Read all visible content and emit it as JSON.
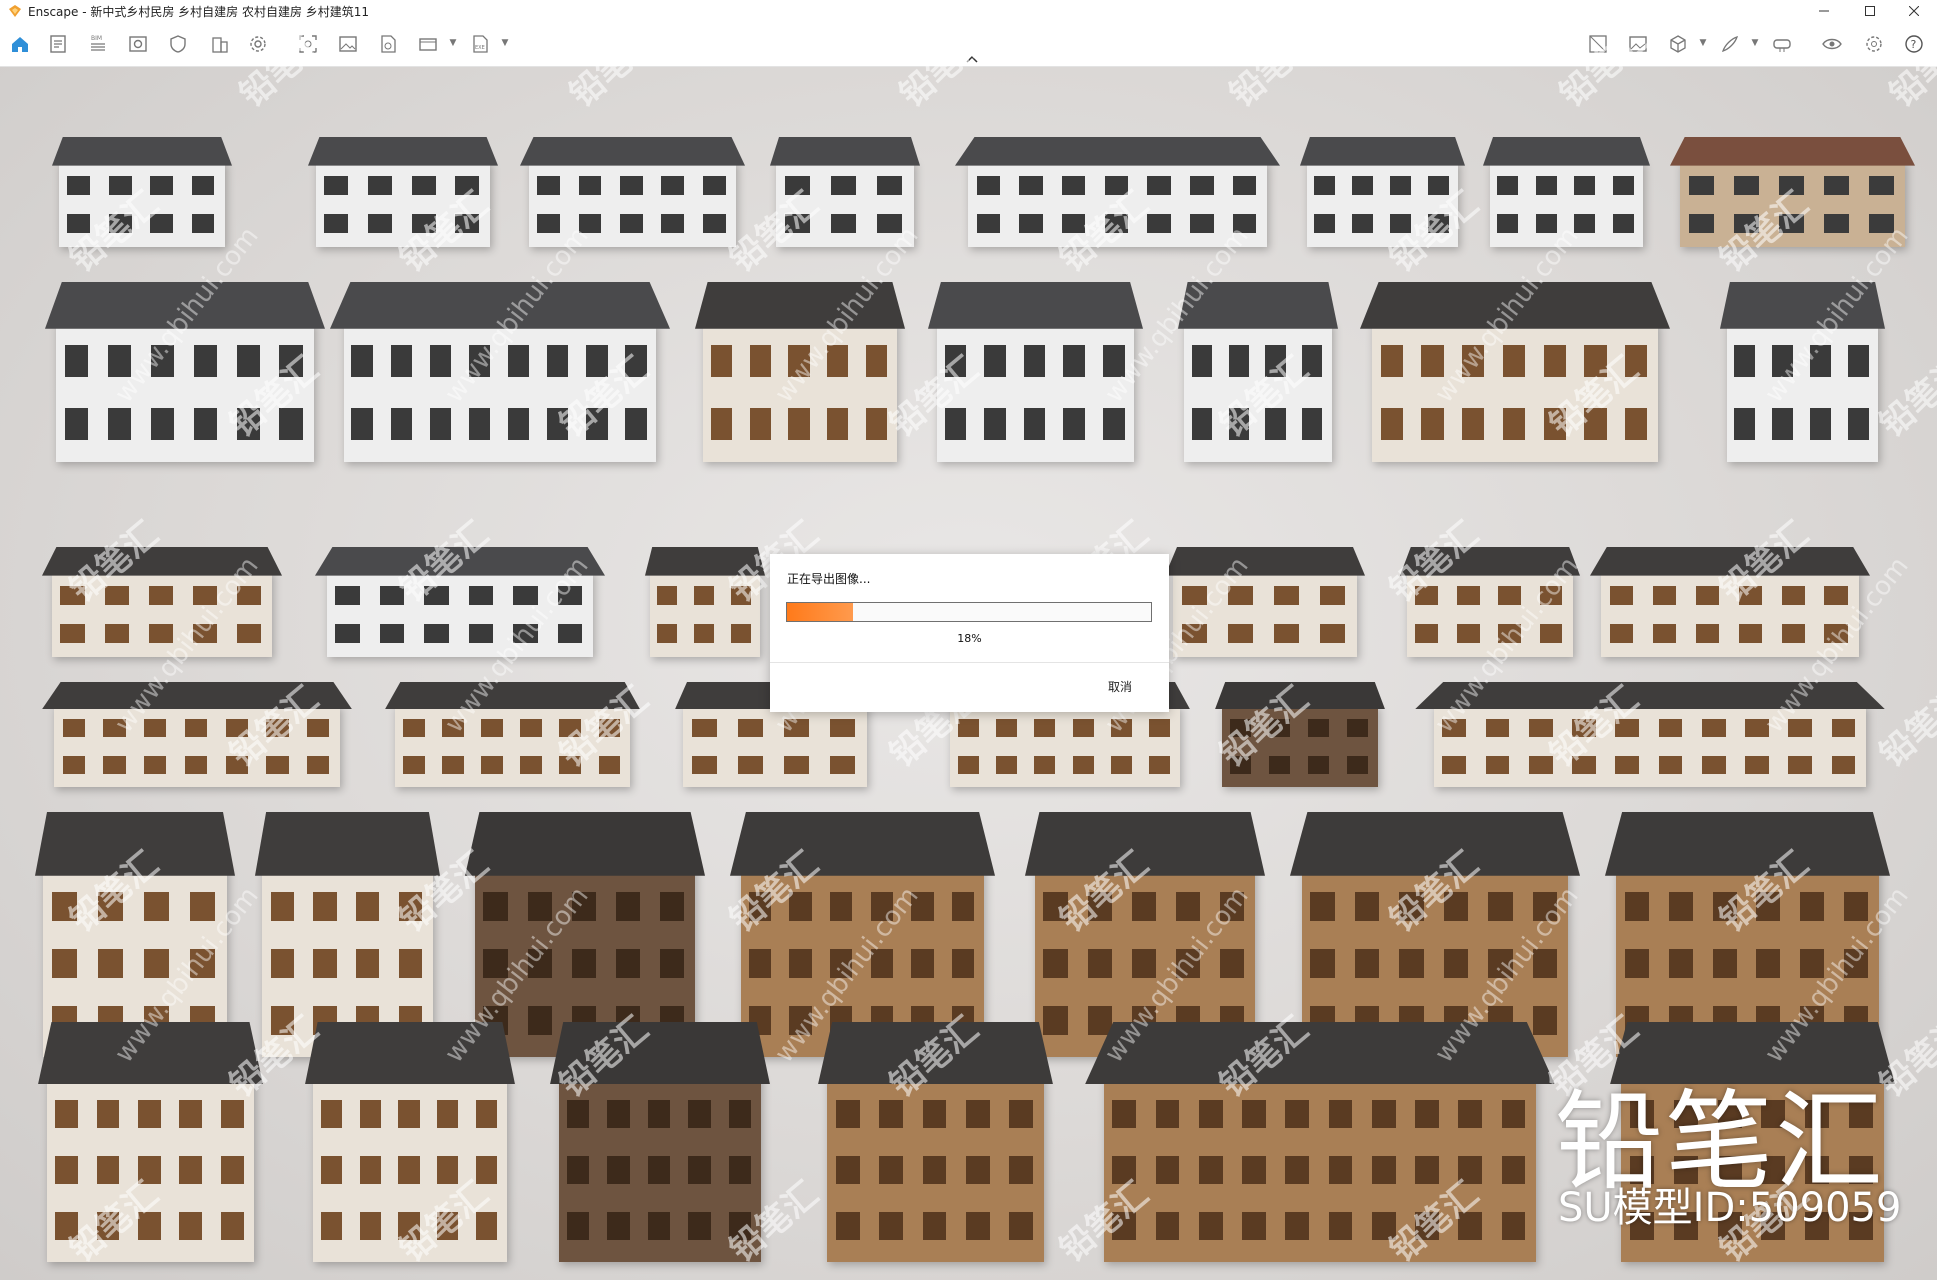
{
  "window": {
    "title": "Enscape - 新中式乡村民房 乡村自建房 农村自建房 乡村建筑11",
    "accent": "#f0a030"
  },
  "toolbar": {
    "left_icons": [
      "home-icon",
      "document-icon",
      "bim-icon",
      "visual-settings-icon",
      "shield-icon",
      "building-icon",
      "settings-gear-icon",
      "screenshot-icon",
      "image-icon",
      "batch-render-icon",
      "video-icon",
      "export-icon"
    ],
    "right_icons": [
      "material-icon",
      "image-gallery-icon",
      "cube-icon",
      "brush-icon",
      "vr-icon",
      "view-icon",
      "gear-icon",
      "help-icon"
    ]
  },
  "dialog": {
    "message": "正在导出图像...",
    "progress_percent": 18,
    "percent_label": "18%",
    "cancel_label": "取消",
    "progress_color": "#ff7a1a"
  },
  "watermark": {
    "brand": "铅笔汇",
    "model_id": "SU模型ID:509059",
    "small": "铅笔汇",
    "url": "www.qbihui.com"
  }
}
